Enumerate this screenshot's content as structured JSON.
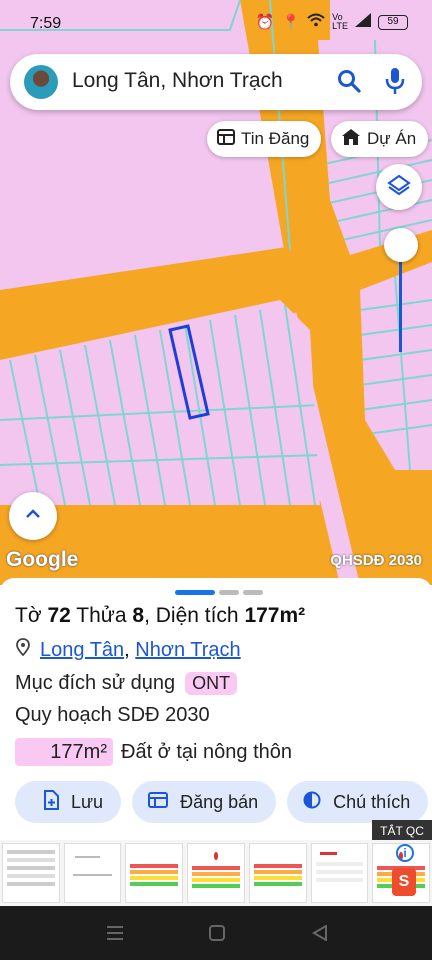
{
  "status": {
    "time": "7:59",
    "battery": "59"
  },
  "search": {
    "query": "Long Tân, Nhơn Trạch"
  },
  "chips": {
    "listing": "Tin Đăng",
    "project": "Dự Án"
  },
  "map": {
    "brand": "Google",
    "layer": "QHSDĐ 2030"
  },
  "sheet": {
    "title": {
      "to_label": "Tờ",
      "to_value": "72",
      "thua_label": "Thửa",
      "thua_value": "8",
      "area_label": ", Diện tích",
      "area_value": "177m²"
    },
    "location": {
      "commune": "Long Tân",
      "separator": ",",
      "district": "Nhơn Trạch"
    },
    "purpose_label": "Mục đích sử dụng",
    "purpose_code": "ONT",
    "plan_label": "Quy hoạch SDĐ 2030",
    "plan_area": "177m²",
    "plan_type": "Đất ở tại nông thôn",
    "actions": {
      "save": "Lưu",
      "post_sale": "Đăng bán",
      "legend": "Chú thích"
    }
  },
  "ad": {
    "close_label": "TẮT QC",
    "info": "i"
  },
  "colors": {
    "accent": "#1a73e8",
    "road": "#f5a623",
    "residential": "#f3c6f0",
    "parcel_line": "#7fd6d0"
  }
}
